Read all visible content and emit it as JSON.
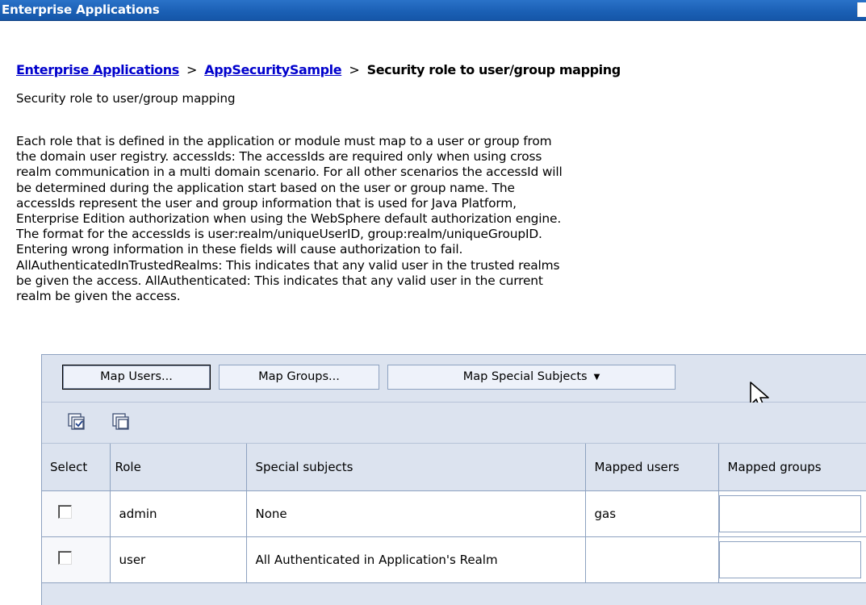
{
  "window": {
    "title": "Enterprise Applications"
  },
  "breadcrumb": {
    "items": [
      {
        "label": "Enterprise Applications"
      },
      {
        "label": "AppSecuritySample"
      }
    ],
    "separator": ">",
    "current": "Security role to user/group mapping"
  },
  "page": {
    "subtitle": "Security role to user/group mapping",
    "description": "Each role that is defined in the application or module must map to a user or group from\nthe domain user registry. accessIds: The accessIds are required only when using cross\nrealm communication in a multi domain scenario. For all other scenarios the accessId will\nbe determined during the application start based on the user or group name. The\naccessIds represent the user and group information that is used for Java Platform,\nEnterprise Edition authorization when using the WebSphere default authorization engine.\nThe format for the accessIds is user:realm/uniqueUserID, group:realm/uniqueGroupID.\nEntering wrong information in these fields will cause authorization to fail.\nAllAuthenticatedInTrustedRealms: This indicates that any valid user in the trusted realms\nbe given the access. AllAuthenticated: This indicates that any valid user in the current\nrealm be given the access."
  },
  "toolbar": {
    "map_users_label": "Map Users...",
    "map_groups_label": "Map Groups...",
    "map_special_label": "Map Special Subjects",
    "caret": "▼"
  },
  "icons": {
    "select_all": "select-all-icon",
    "deselect_all": "deselect-all-icon"
  },
  "table": {
    "headers": {
      "select": "Select",
      "role": "Role",
      "special": "Special subjects",
      "mapped_users": "Mapped users",
      "mapped_groups": "Mapped groups"
    },
    "rows": [
      {
        "role": "admin",
        "special": "None",
        "mapped_users": "gas",
        "mapped_groups": ""
      },
      {
        "role": "user",
        "special": "All Authenticated in Application's Realm",
        "mapped_users": "",
        "mapped_groups": ""
      }
    ]
  },
  "colors": {
    "titlebar": "#1a5fb4",
    "link": "#0000cc",
    "panel": "#dce3ef",
    "border": "#8ea2c0"
  }
}
